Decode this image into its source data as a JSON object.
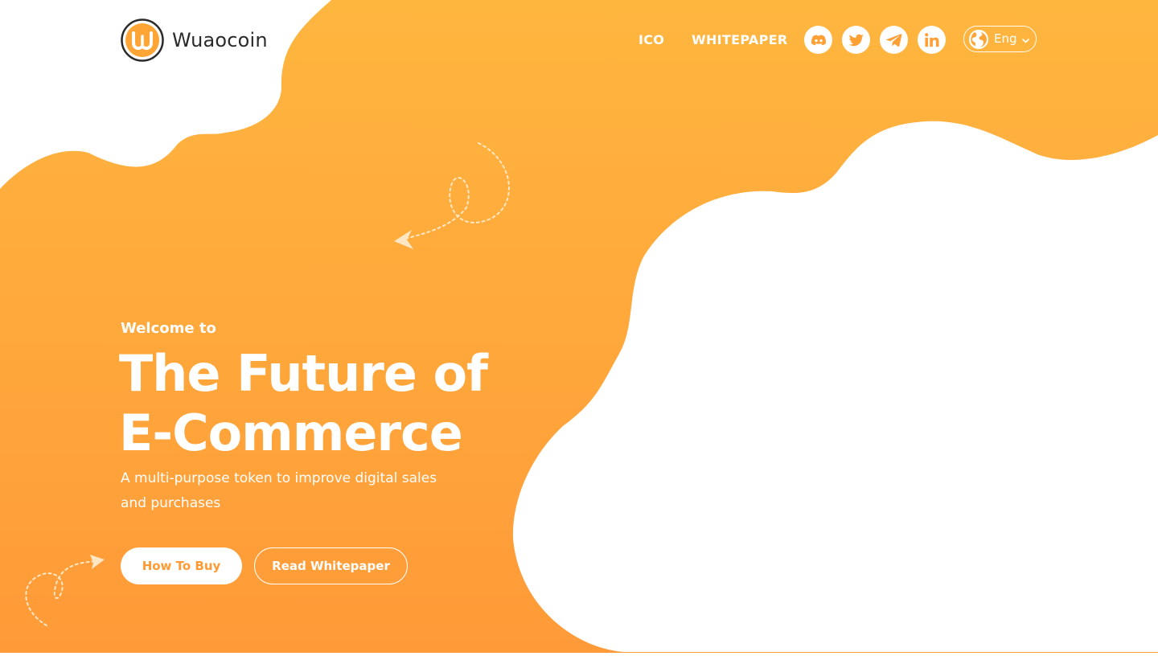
{
  "brand": {
    "name": "Wuaocoin"
  },
  "nav": {
    "links": [
      "ICO",
      "WHITEPAPER"
    ]
  },
  "social": {
    "icons": [
      "discord-icon",
      "twitter-icon",
      "telegram-icon",
      "linkedin-icon"
    ]
  },
  "language": {
    "label": "Eng",
    "icons": [
      "globe-icon",
      "chevron-down-icon"
    ]
  },
  "hero": {
    "kicker": "Welcome to",
    "title_line1": "The Future of",
    "title_line2": "E-Commerce",
    "subtitle": "A multi-purpose token to improve digital sales and purchases",
    "primary_button": "How To Buy",
    "secondary_button": "Read Whitepaper"
  },
  "colors": {
    "orange_top": "#ffb63f",
    "orange_bottom": "#ff9a38",
    "text_dark": "#2b2b2b",
    "white": "#ffffff"
  }
}
